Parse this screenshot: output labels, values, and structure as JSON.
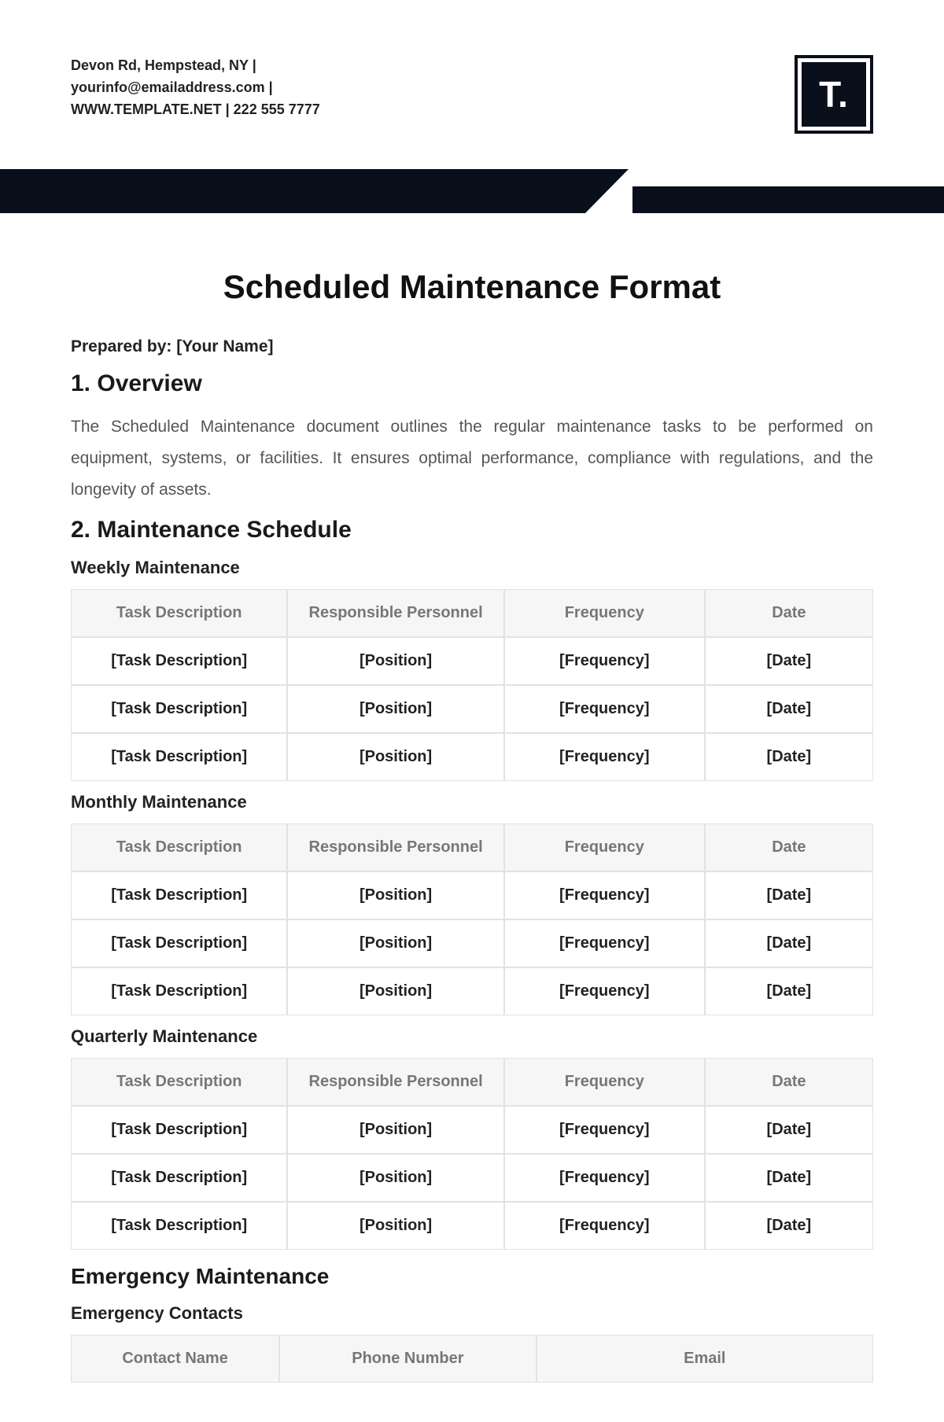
{
  "header": {
    "contact_lines": "Devon Rd, Hempstead, NY | yourinfo@emailaddress.com | WWW.TEMPLATE.NET | 222 555 7777",
    "logo_text": "T."
  },
  "title": "Scheduled Maintenance Format",
  "prepared_by": "Prepared by: [Your Name]",
  "section1_heading": "1. Overview",
  "overview_body": "The Scheduled Maintenance document outlines the regular maintenance tasks to be performed on equipment, systems, or facilities. It ensures optimal performance, compliance with regulations, and the longevity of assets.",
  "section2_heading": "2. Maintenance Schedule",
  "schedule_headers": {
    "task": "Task Description",
    "resp": "Responsible Personnel",
    "freq": "Frequency",
    "date": "Date"
  },
  "weekly_label": "Weekly Maintenance",
  "monthly_label": "Monthly Maintenance",
  "quarterly_label": "Quarterly Maintenance",
  "weekly_rows": [
    {
      "task": "[Task Description]",
      "resp": "[Position]",
      "freq": "[Frequency]",
      "date": "[Date]"
    },
    {
      "task": "[Task Description]",
      "resp": "[Position]",
      "freq": "[Frequency]",
      "date": "[Date]"
    },
    {
      "task": "[Task Description]",
      "resp": "[Position]",
      "freq": "[Frequency]",
      "date": "[Date]"
    }
  ],
  "monthly_rows": [
    {
      "task": "[Task Description]",
      "resp": "[Position]",
      "freq": "[Frequency]",
      "date": "[Date]"
    },
    {
      "task": "[Task Description]",
      "resp": "[Position]",
      "freq": "[Frequency]",
      "date": "[Date]"
    },
    {
      "task": "[Task Description]",
      "resp": "[Position]",
      "freq": "[Frequency]",
      "date": "[Date]"
    }
  ],
  "quarterly_rows": [
    {
      "task": "[Task Description]",
      "resp": "[Position]",
      "freq": "[Frequency]",
      "date": "[Date]"
    },
    {
      "task": "[Task Description]",
      "resp": "[Position]",
      "freq": "[Frequency]",
      "date": "[Date]"
    },
    {
      "task": "[Task Description]",
      "resp": "[Position]",
      "freq": "[Frequency]",
      "date": "[Date]"
    }
  ],
  "emergency_heading": "Emergency Maintenance",
  "emergency_contacts_label": "Emergency Contacts",
  "contact_headers": {
    "name": "Contact Name",
    "phone": "Phone Number",
    "email": "Email"
  }
}
